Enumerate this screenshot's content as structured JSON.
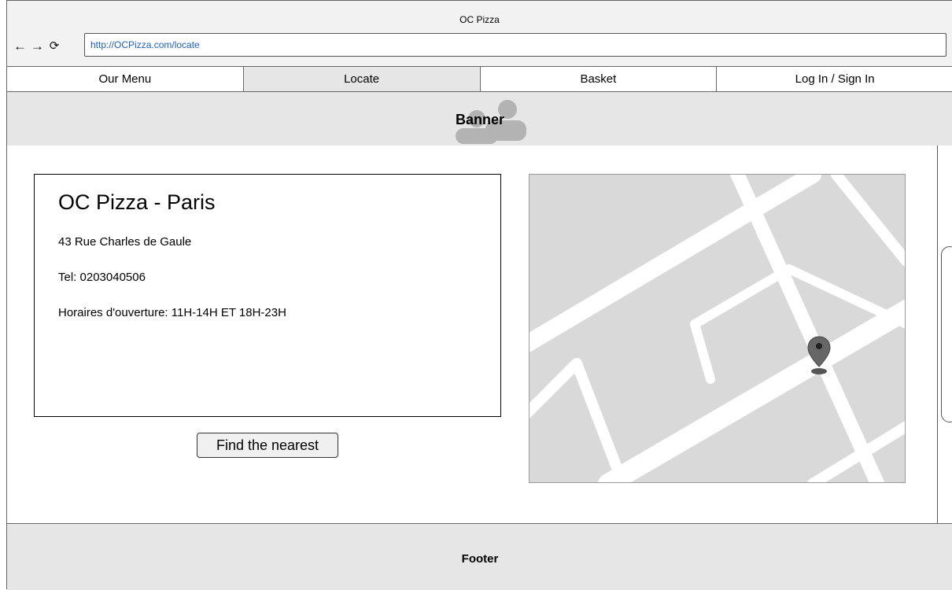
{
  "window": {
    "title": "OC Pizza"
  },
  "browser": {
    "url": "http://OCPizza.com/locate",
    "back_icon": "arrow-left-icon",
    "forward_icon": "arrow-right-icon",
    "reload_icon": "reload-icon"
  },
  "tabs": [
    {
      "label": "Our Menu",
      "active": false
    },
    {
      "label": "Locate",
      "active": true
    },
    {
      "label": "Basket",
      "active": false
    },
    {
      "label": "Log In / Sign In",
      "active": false
    }
  ],
  "banner": {
    "label": "Banner"
  },
  "store": {
    "name": "OC Pizza - Paris",
    "address": "43 Rue Charles de Gaule",
    "phone": "Tel: 0203040506",
    "hours": "Horaires d'ouverture:  11H-14H ET 18H-23H"
  },
  "actions": {
    "find_nearest": "Find the nearest"
  },
  "map": {
    "marker_icon": "map-pin-icon"
  },
  "footer": {
    "label": "Footer"
  },
  "colors": {
    "link": "#1a5fcc",
    "panel": "#e6e6e6",
    "map_bg": "#d9d9d9"
  }
}
